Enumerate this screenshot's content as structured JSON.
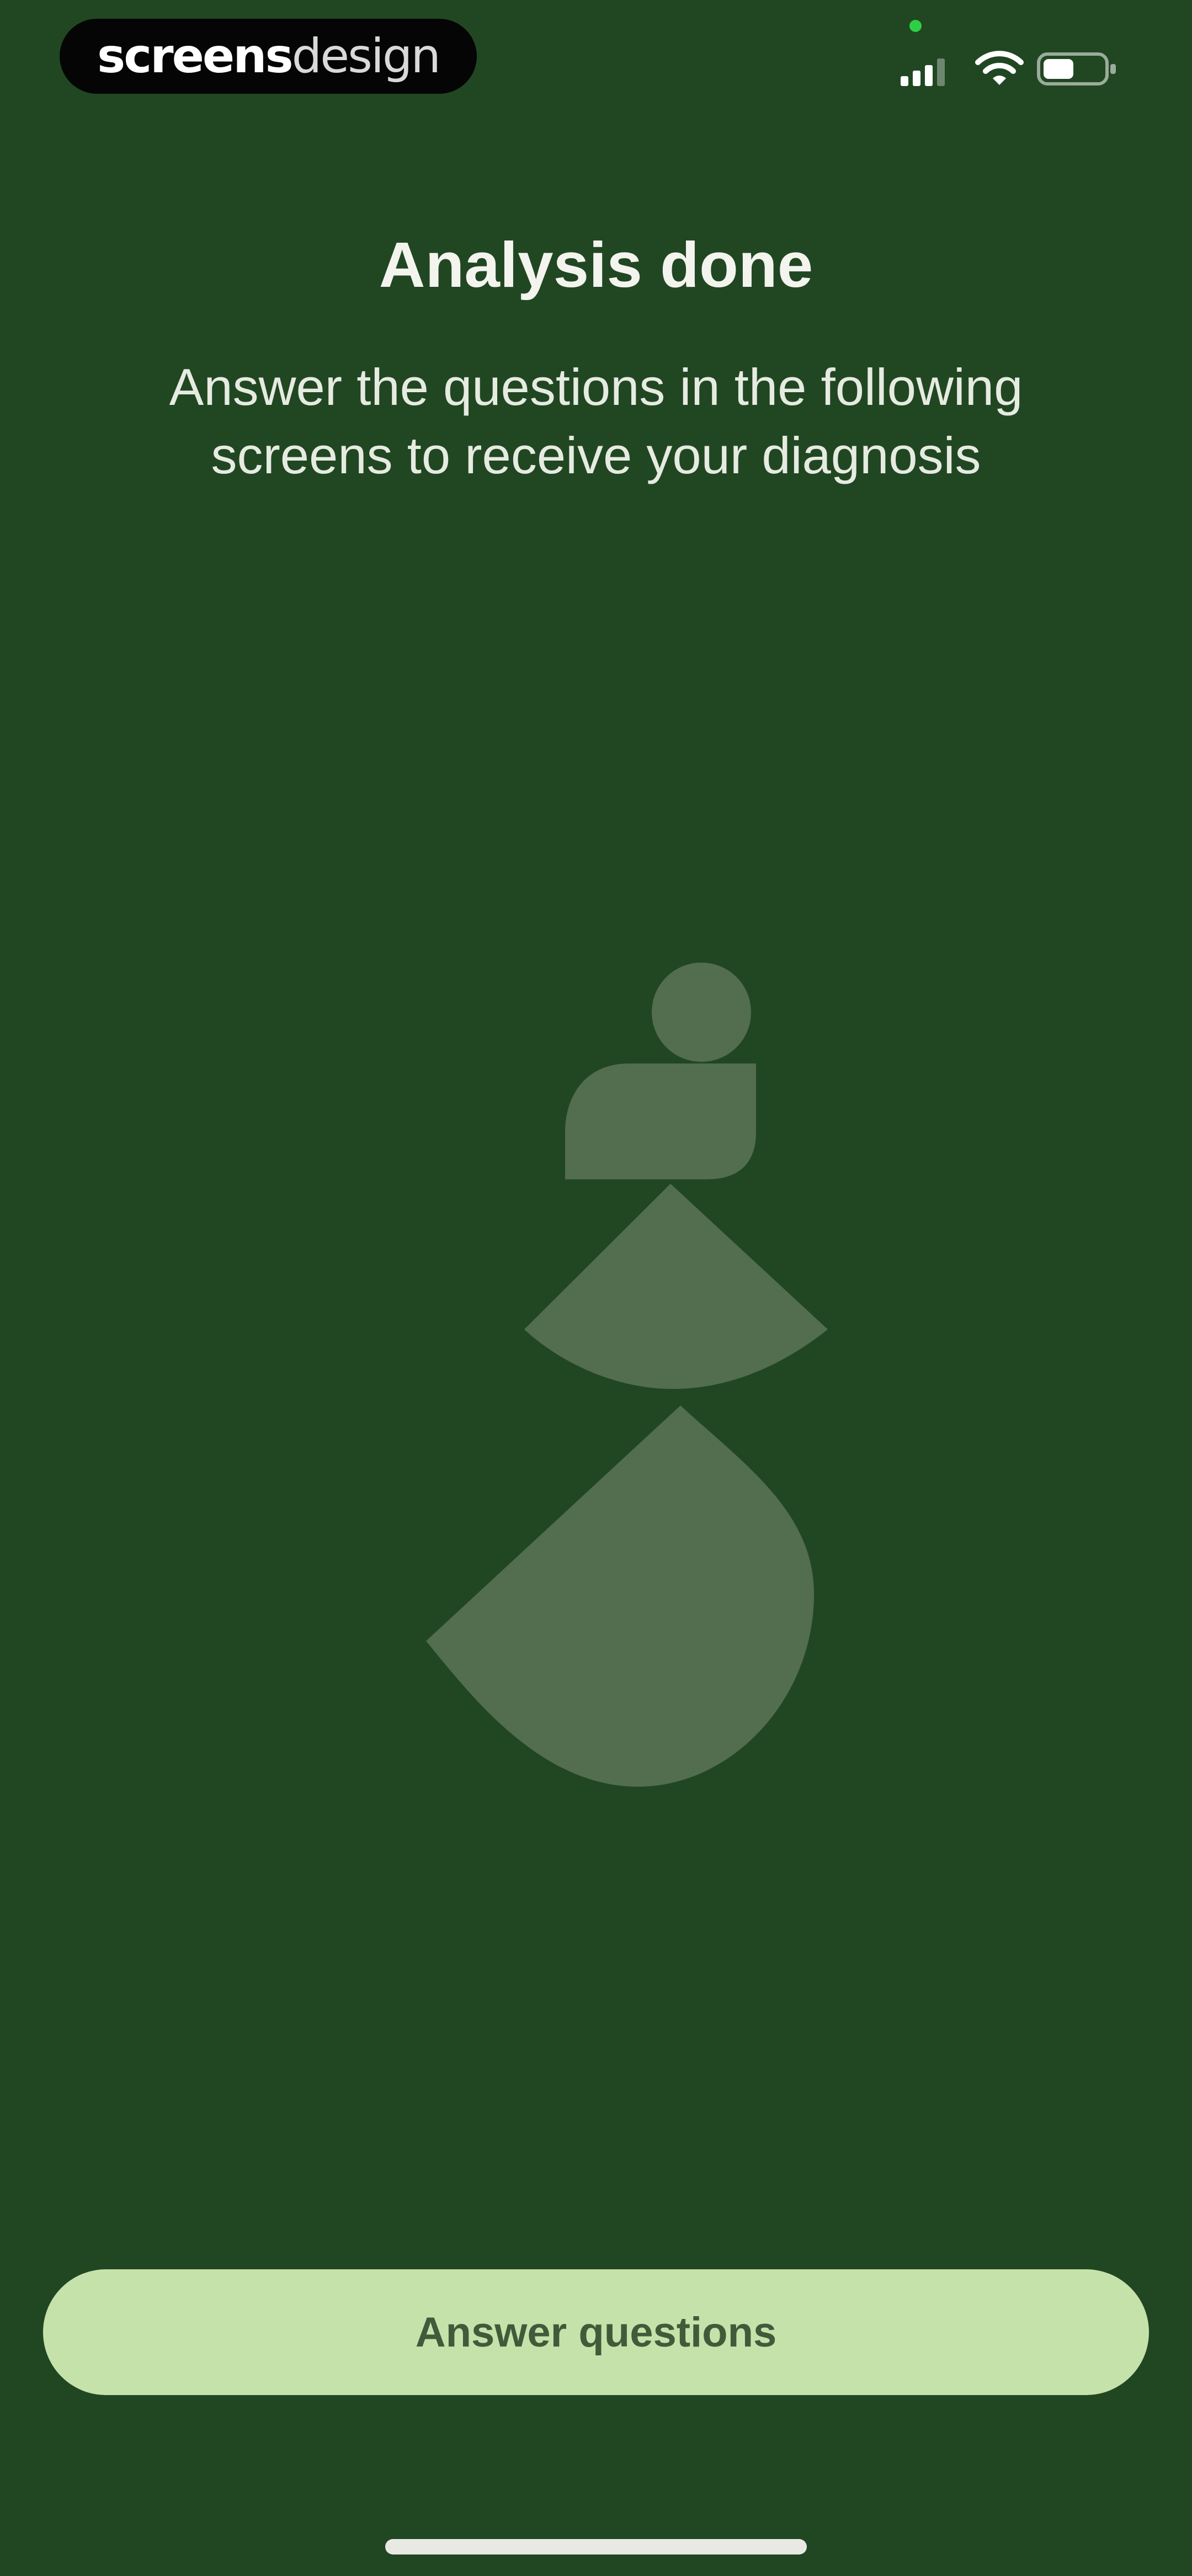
{
  "status_bar": {
    "brand_strong": "screens",
    "brand_light": "design",
    "signal_icon": "cellular-signal-icon",
    "wifi_icon": "wifi-icon",
    "battery_icon": "battery-icon",
    "battery_level": 0.5
  },
  "header": {
    "title": "Analysis done",
    "subtitle": "Answer the questions in the following screens to receive your diagnosis"
  },
  "illustration": {
    "name": "stacked-shapes-illustration",
    "color": "#536d4f"
  },
  "cta": {
    "label": "Answer questions"
  },
  "colors": {
    "background": "#214722",
    "cta_background": "#c6e2ab",
    "cta_text": "#3f5b3a",
    "text": "#f4f4ef"
  }
}
